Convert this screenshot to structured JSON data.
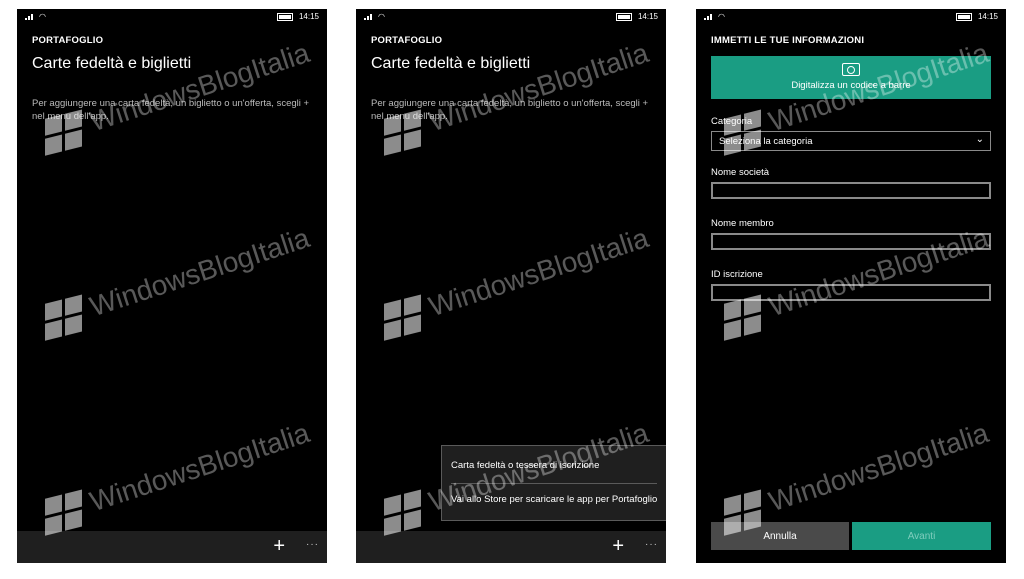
{
  "status": {
    "time": "14:15"
  },
  "watermark": "WindowsBlogItalia",
  "screen1": {
    "app_title": "PORTAFOGLIO",
    "page_title": "Carte fedeltà e biglietti",
    "description": "Per aggiungere una carta fedeltà, un biglietto o un'offerta, scegli + nel menu dell'app.",
    "add_icon": "+",
    "more_icon": "···"
  },
  "screen2": {
    "app_title": "PORTAFOGLIO",
    "page_title": "Carte fedeltà e biglietti",
    "description": "Per aggiungere una carta fedeltà, un biglietto o un'offerta, scegli + nel menu dell'app.",
    "menu": [
      "Carta fedeltà o tessera di iscrizione",
      "Vai allo Store per scaricare le app per Portafoglio"
    ],
    "add_icon": "+",
    "more_icon": "···"
  },
  "screen3": {
    "app_title": "IMMETTI LE TUE INFORMAZIONI",
    "scan_label": "Digitalizza un codice a barre",
    "category_label": "Categoria",
    "category_value": "Seleziona la categoria",
    "company_label": "Nome società",
    "member_label": "Nome membro",
    "id_label": "ID iscrizione",
    "cancel_label": "Annulla",
    "next_label": "Avanti"
  },
  "colors": {
    "accent": "#1a9d83",
    "background": "#000000",
    "appbar": "#1f1f1f"
  }
}
